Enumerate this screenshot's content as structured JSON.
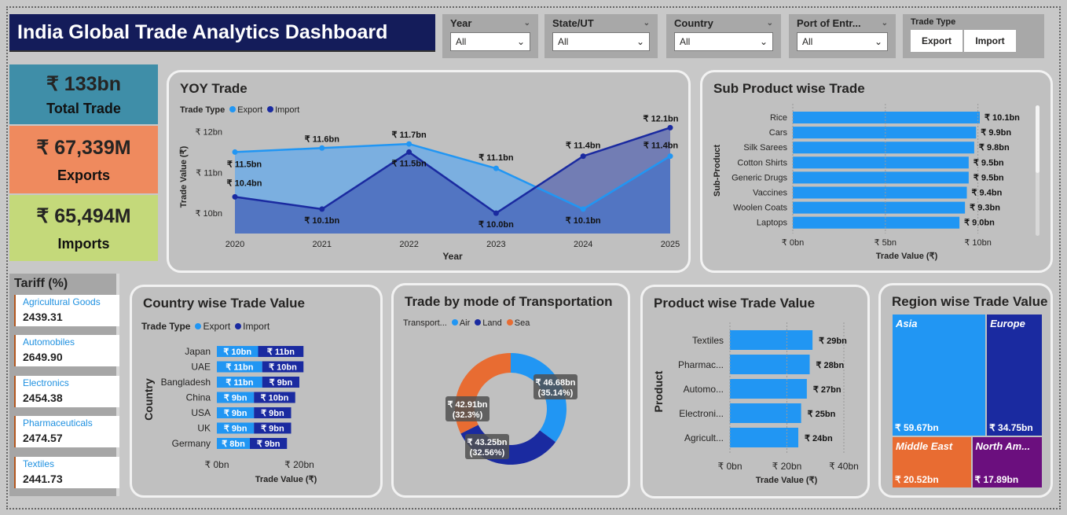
{
  "title": "India Global Trade Analytics Dashboard",
  "slicers": [
    {
      "label": "Year",
      "value": "All"
    },
    {
      "label": "State/UT",
      "value": "All"
    },
    {
      "label": "Country",
      "value": "All"
    },
    {
      "label": "Port of Entr...",
      "value": "All"
    }
  ],
  "trade_type": {
    "label": "Trade Type",
    "options": [
      "Export",
      "Import"
    ]
  },
  "kpis": [
    {
      "value": "₹ 133bn",
      "label": "Total Trade",
      "color": "#3f8ea8"
    },
    {
      "value": "₹ 67,339M",
      "label": "Exports",
      "color": "#ef8a5e"
    },
    {
      "value": "₹ 65,494M",
      "label": "Imports",
      "color": "#c4d97a"
    }
  ],
  "tariff": {
    "title": "Tariff (%)",
    "items": [
      {
        "name": "Agricultural Goods",
        "value": "2439.31"
      },
      {
        "name": "Automobiles",
        "value": "2649.90"
      },
      {
        "name": "Electronics",
        "value": "2454.38"
      },
      {
        "name": "Pharmaceuticals",
        "value": "2474.57"
      },
      {
        "name": "Textiles",
        "value": "2441.73"
      }
    ]
  },
  "colors": {
    "export": "#2196f3",
    "import": "#1a2aa0",
    "air": "#2196f3",
    "land": "#1a2aa0",
    "sea": "#e86c32"
  },
  "chart_data": [
    {
      "id": "yoy",
      "type": "line",
      "title": "YOY Trade",
      "legend_title": "Trade Type",
      "xlabel": "Year",
      "ylabel": "Trade Value (₹)",
      "x": [
        "2020",
        "2021",
        "2022",
        "2023",
        "2024",
        "2025"
      ],
      "yticks": [
        "₹ 10bn",
        "₹ 11bn",
        "₹ 12bn"
      ],
      "ytick_values": [
        10,
        11,
        12
      ],
      "series": [
        {
          "name": "Export",
          "values": [
            11.5,
            11.6,
            11.7,
            11.1,
            10.1,
            11.4
          ],
          "labels": [
            "₹ 11.5bn",
            "₹ 11.6bn",
            "₹ 11.7bn",
            "₹ 11.1bn",
            "₹ 10.1bn",
            "₹ 11.4bn"
          ]
        },
        {
          "name": "Import",
          "values": [
            10.4,
            10.1,
            11.5,
            10.0,
            11.4,
            12.1
          ],
          "labels": [
            "₹ 10.4bn",
            "₹ 10.1bn",
            "₹ 11.5bn",
            "₹ 10.0bn",
            "₹ 11.4bn",
            "₹ 12.1bn"
          ]
        }
      ]
    },
    {
      "id": "subproduct",
      "type": "bar",
      "title": "Sub Product wise Trade",
      "xlabel": "Trade Value (₹)",
      "ylabel": "Sub-Product",
      "categories": [
        "Rice",
        "Cars",
        "Silk Sarees",
        "Cotton Shirts",
        "Generic Drugs",
        "Vaccines",
        "Woolen Coats",
        "Laptops"
      ],
      "values": [
        10.1,
        9.9,
        9.8,
        9.5,
        9.5,
        9.4,
        9.3,
        9.0
      ],
      "labels": [
        "₹ 10.1bn",
        "₹ 9.9bn",
        "₹ 9.8bn",
        "₹ 9.5bn",
        "₹ 9.5bn",
        "₹ 9.4bn",
        "₹ 9.3bn",
        "₹ 9.0bn"
      ],
      "xticks": [
        "₹ 0bn",
        "₹ 5bn",
        "₹ 10bn"
      ],
      "xtick_values": [
        0,
        5,
        10
      ]
    },
    {
      "id": "country",
      "type": "bar",
      "title": "Country wise Trade Value",
      "legend_title": "Trade Type",
      "xlabel": "Trade Value (₹)",
      "ylabel": "Country",
      "categories": [
        "Japan",
        "UAE",
        "Bangladesh",
        "China",
        "USA",
        "UK",
        "Germany"
      ],
      "series": [
        {
          "name": "Export",
          "values": [
            10,
            11,
            11,
            9,
            9,
            9,
            8
          ],
          "labels": [
            "₹ 10bn",
            "₹ 11bn",
            "₹ 11bn",
            "₹ 9bn",
            "₹ 9bn",
            "₹ 9bn",
            "₹ 8bn"
          ]
        },
        {
          "name": "Import",
          "values": [
            11,
            10,
            9,
            10,
            9,
            9,
            9
          ],
          "labels": [
            "₹ 11bn",
            "₹ 10bn",
            "₹ 9bn",
            "₹ 10bn",
            "₹ 9bn",
            "₹ 9bn",
            "₹ 9bn"
          ]
        }
      ],
      "xticks": [
        "₹ 0bn",
        "₹ 20bn"
      ],
      "xtick_values": [
        0,
        20
      ]
    },
    {
      "id": "transport",
      "type": "pie",
      "title": "Trade by mode of Transportation",
      "legend_title": "Transport...",
      "categories": [
        "Air",
        "Land",
        "Sea"
      ],
      "values": [
        46.68,
        43.25,
        42.91
      ],
      "labels": [
        "₹ 46.68bn",
        "₹ 43.25bn",
        "₹ 42.91bn"
      ],
      "percents": [
        "(35.14%)",
        "(32.56%)",
        "(32.3%)"
      ]
    },
    {
      "id": "product",
      "type": "bar",
      "title": "Product wise Trade Value",
      "xlabel": "Trade Value (₹)",
      "ylabel": "Product",
      "categories": [
        "Textiles",
        "Pharmac...",
        "Automo...",
        "Electroni...",
        "Agricult..."
      ],
      "values": [
        29,
        28,
        27,
        25,
        24
      ],
      "labels": [
        "₹ 29bn",
        "₹ 28bn",
        "₹ 27bn",
        "₹ 25bn",
        "₹ 24bn"
      ],
      "xticks": [
        "₹ 0bn",
        "₹ 20bn",
        "₹ 40bn"
      ],
      "xtick_values": [
        0,
        20,
        40
      ]
    },
    {
      "id": "region",
      "type": "heatmap",
      "title": "Region wise Trade Value",
      "categories": [
        "Asia",
        "Europe",
        "Middle East",
        "North Am..."
      ],
      "values": [
        59.67,
        34.75,
        20.52,
        17.89
      ],
      "labels": [
        "₹ 59.67bn",
        "₹ 34.75bn",
        "₹ 20.52bn",
        "₹ 17.89bn"
      ],
      "colors": [
        "#2196f3",
        "#1a2aa0",
        "#e86c32",
        "#6b0f7e"
      ]
    }
  ]
}
